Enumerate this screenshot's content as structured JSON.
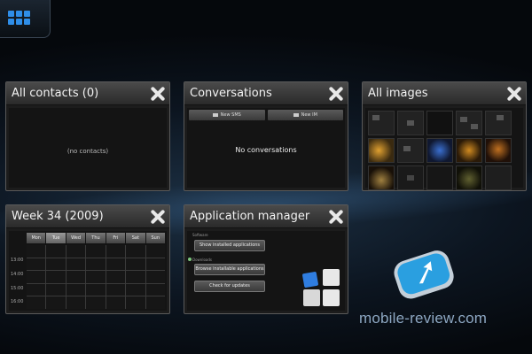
{
  "launcher": {
    "icon": "app-grid-icon"
  },
  "cards": {
    "contacts": {
      "title": "All contacts (0)",
      "empty_text": "(no contacts)"
    },
    "conversations": {
      "title": "Conversations",
      "new_sms_label": "New SMS",
      "new_im_label": "New IM",
      "empty_text": "No conversations"
    },
    "images": {
      "title": "All images"
    },
    "calendar": {
      "title": "Week 34 (2009)",
      "days": [
        "Mon",
        "Tue",
        "Wed",
        "Thu",
        "Fri",
        "Sat",
        "Sun"
      ],
      "hours": [
        "",
        "13:00",
        "14:00",
        "15:00",
        "16:00"
      ]
    },
    "appmanager": {
      "title": "Application manager",
      "section1": "Software",
      "btn1": "Show installed applications",
      "section2": "Downloads",
      "btn2": "Browse installable applications",
      "btn3": "Check for updates"
    }
  },
  "watermark": {
    "text": "mobile-review.com"
  },
  "colors": {
    "accent": "#2f8ee8",
    "background": "#05080c"
  }
}
